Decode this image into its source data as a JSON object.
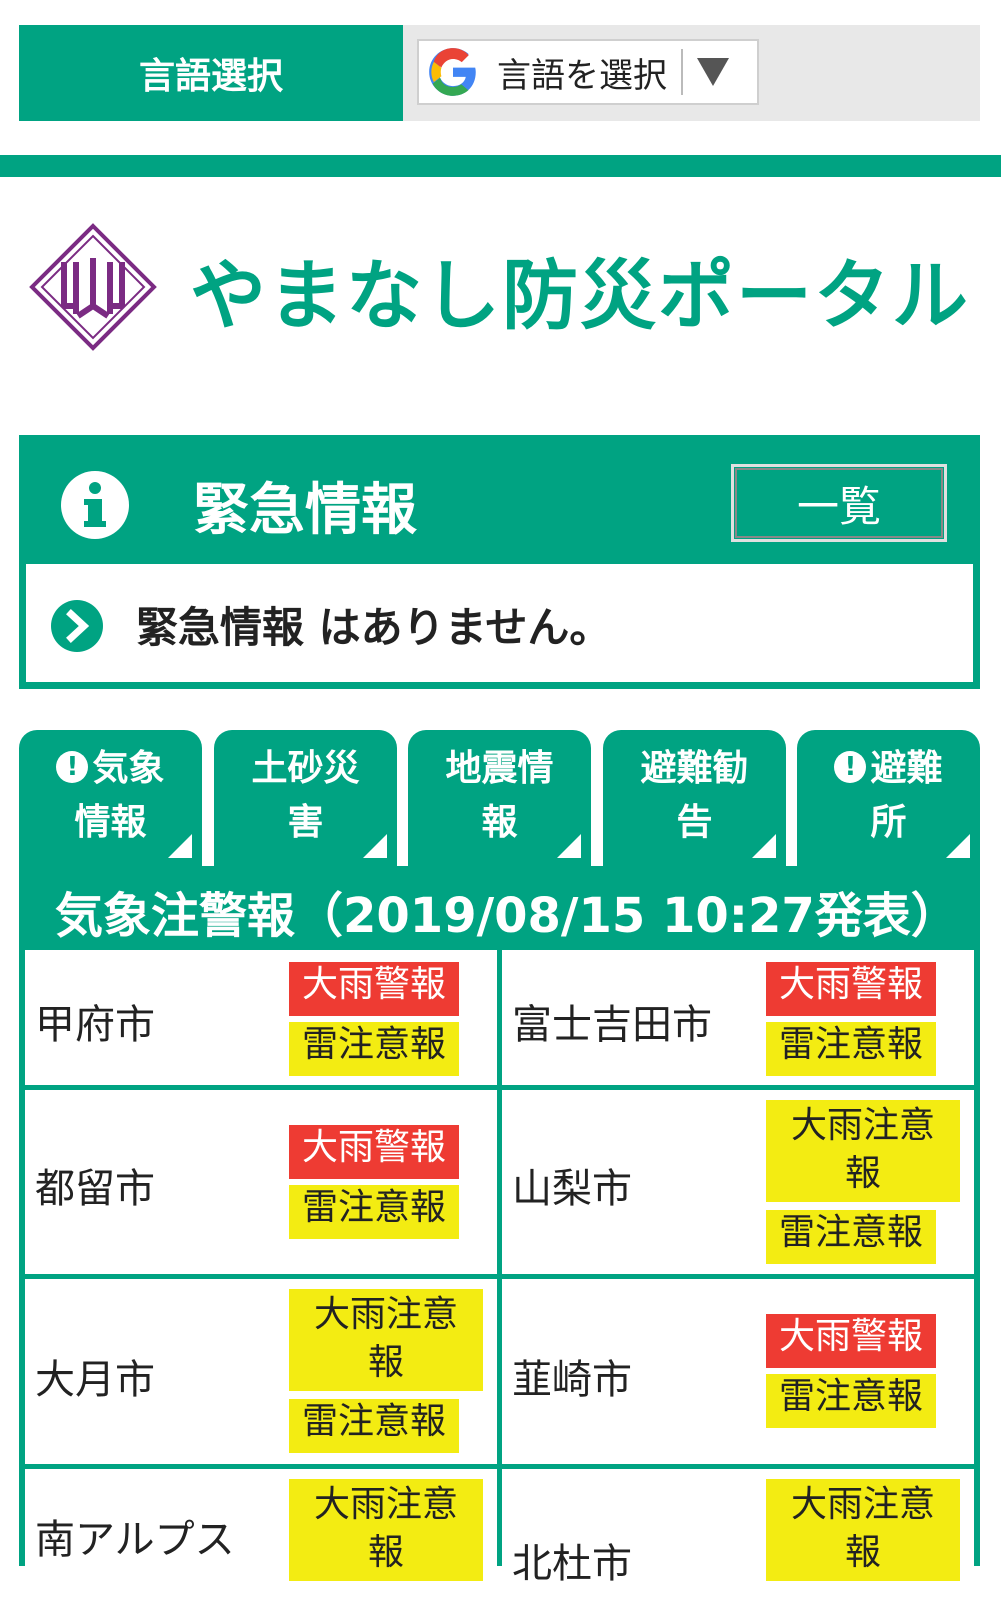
{
  "language": {
    "label": "言語選択",
    "select_text": "言語を選択"
  },
  "header": {
    "title": "やまなし防災ポータル"
  },
  "emergency": {
    "title": "緊急情報",
    "list_button": "一覧",
    "message": "緊急情報 はありません。"
  },
  "tabs": [
    {
      "line1": "気象",
      "line2": "情報",
      "alert": true
    },
    {
      "line1": "土砂災",
      "line2": "害",
      "alert": false
    },
    {
      "line1": "地震情",
      "line2": "報",
      "alert": false
    },
    {
      "line1": "避難勧",
      "line2": "告",
      "alert": false
    },
    {
      "line1": "避難",
      "line2": "所",
      "alert": true
    }
  ],
  "weather": {
    "title": "気象注警報（2019/08/15 10:27発表）",
    "cities": [
      {
        "name": "甲府市",
        "badges": [
          {
            "text": "大雨警報",
            "level": "warning"
          },
          {
            "text": "雷注意報",
            "level": "advisory"
          }
        ]
      },
      {
        "name": "富士吉田市",
        "badges": [
          {
            "text": "大雨警報",
            "level": "warning"
          },
          {
            "text": "雷注意報",
            "level": "advisory"
          }
        ]
      },
      {
        "name": "都留市",
        "badges": [
          {
            "text": "大雨警報",
            "level": "warning"
          },
          {
            "text": "雷注意報",
            "level": "advisory"
          }
        ]
      },
      {
        "name": "山梨市",
        "badges": [
          {
            "text": "大雨注意報",
            "level": "advisory"
          },
          {
            "text": "雷注意報",
            "level": "advisory"
          }
        ]
      },
      {
        "name": "大月市",
        "badges": [
          {
            "text": "大雨注意報",
            "level": "advisory"
          },
          {
            "text": "雷注意報",
            "level": "advisory"
          }
        ]
      },
      {
        "name": "韮崎市",
        "badges": [
          {
            "text": "大雨警報",
            "level": "warning"
          },
          {
            "text": "雷注意報",
            "level": "advisory"
          }
        ]
      },
      {
        "name": "南アルプス",
        "badges": [
          {
            "text": "大雨注意報",
            "level": "advisory"
          }
        ]
      },
      {
        "name": "北杜市",
        "badges": [
          {
            "text": "大雨注意報",
            "level": "advisory"
          }
        ]
      }
    ]
  },
  "colors": {
    "brand": "#00a382",
    "warning": "#ee3b33",
    "advisory": "#f3ec12",
    "logo": "#7b2b83"
  }
}
